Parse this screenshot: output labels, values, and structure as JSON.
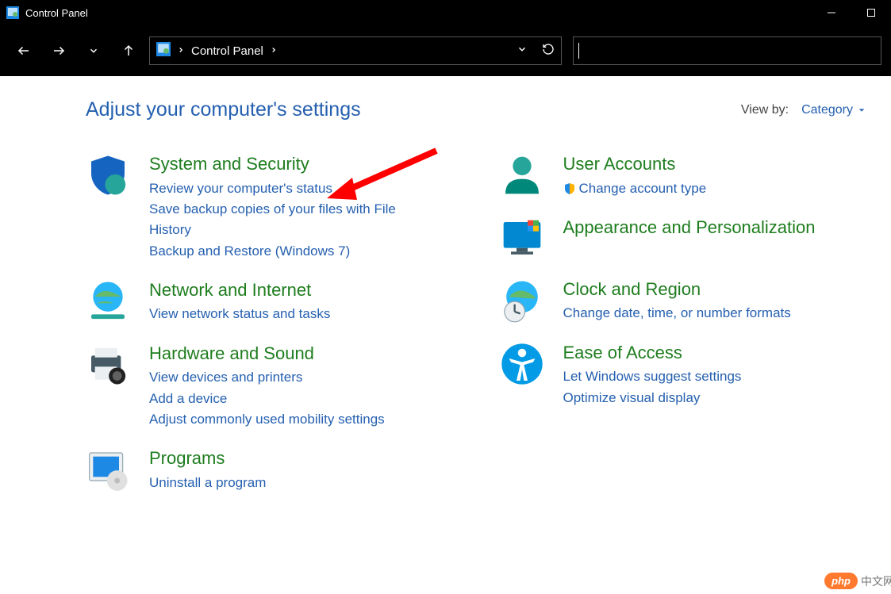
{
  "window": {
    "title": "Control Panel"
  },
  "breadcrumb": {
    "item": "Control Panel"
  },
  "header": {
    "title": "Adjust your computer's settings",
    "viewby_label": "View by:",
    "viewby_value": "Category"
  },
  "col1": {
    "cat0": {
      "title": "System and Security",
      "link0": "Review your computer's status",
      "link1": "Save backup copies of your files with File History",
      "link2": "Backup and Restore (Windows 7)"
    },
    "cat1": {
      "title": "Network and Internet",
      "link0": "View network status and tasks"
    },
    "cat2": {
      "title": "Hardware and Sound",
      "link0": "View devices and printers",
      "link1": "Add a device",
      "link2": "Adjust commonly used mobility settings"
    },
    "cat3": {
      "title": "Programs",
      "link0": "Uninstall a program"
    }
  },
  "col2": {
    "cat0": {
      "title": "User Accounts",
      "link0": "Change account type"
    },
    "cat1": {
      "title": "Appearance and Personalization"
    },
    "cat2": {
      "title": "Clock and Region",
      "link0": "Change date, time, or number formats"
    },
    "cat3": {
      "title": "Ease of Access",
      "link0": "Let Windows suggest settings",
      "link1": "Optimize visual display"
    }
  },
  "watermark": {
    "pill": "php",
    "text": "中文网"
  }
}
